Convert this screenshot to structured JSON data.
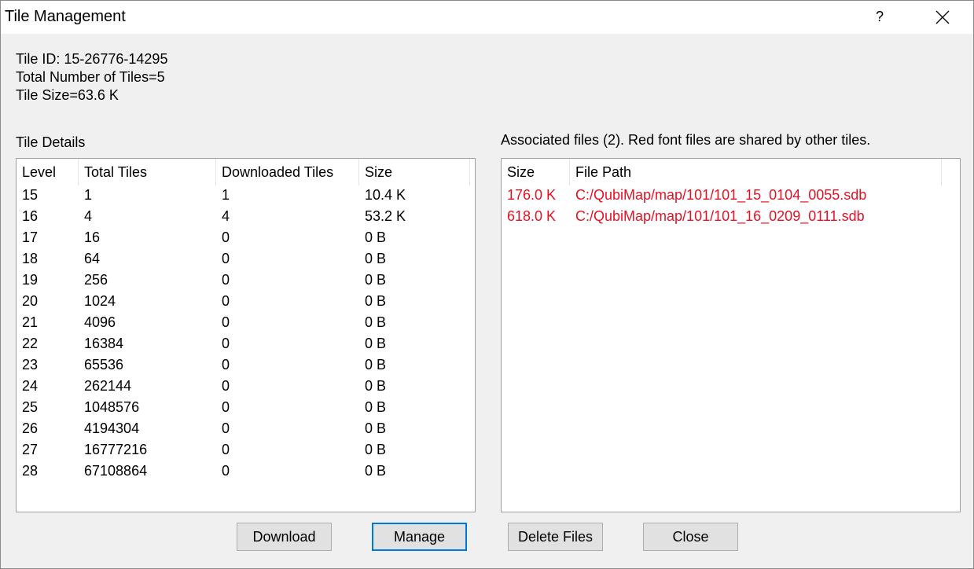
{
  "window": {
    "title": "Tile Management",
    "help": "?"
  },
  "info": {
    "tile_id": "Tile ID: 15-26776-14295",
    "total": "Total Number of Tiles=5",
    "size": "Tile Size=63.6 K"
  },
  "tile_details": {
    "label": "Tile Details",
    "headers": [
      "Level",
      "Total Tiles",
      "Downloaded Tiles",
      "Size"
    ],
    "rows": [
      [
        "15",
        "1",
        "1",
        "10.4 K"
      ],
      [
        "16",
        "4",
        "4",
        "53.2 K"
      ],
      [
        "17",
        "16",
        "0",
        "0 B"
      ],
      [
        "18",
        "64",
        "0",
        "0 B"
      ],
      [
        "19",
        "256",
        "0",
        "0 B"
      ],
      [
        "20",
        "1024",
        "0",
        "0 B"
      ],
      [
        "21",
        "4096",
        "0",
        "0 B"
      ],
      [
        "22",
        "16384",
        "0",
        "0 B"
      ],
      [
        "23",
        "65536",
        "0",
        "0 B"
      ],
      [
        "24",
        "262144",
        "0",
        "0 B"
      ],
      [
        "25",
        "1048576",
        "0",
        "0 B"
      ],
      [
        "26",
        "4194304",
        "0",
        "0 B"
      ],
      [
        "27",
        "16777216",
        "0",
        "0 B"
      ],
      [
        "28",
        "67108864",
        "0",
        "0 B"
      ]
    ]
  },
  "associated": {
    "label": "Associated files (2). Red font files are shared by other tiles.",
    "headers": [
      "Size",
      "File Path"
    ],
    "rows": [
      [
        "176.0 K",
        "C:/QubiMap/map/101/101_15_0104_0055.sdb"
      ],
      [
        "618.0 K",
        "C:/QubiMap/map/101/101_16_0209_0111.sdb"
      ]
    ],
    "shared_color": "#e81123"
  },
  "buttons": {
    "download": "Download",
    "manage": "Manage",
    "delete": "Delete Files",
    "close": "Close"
  }
}
